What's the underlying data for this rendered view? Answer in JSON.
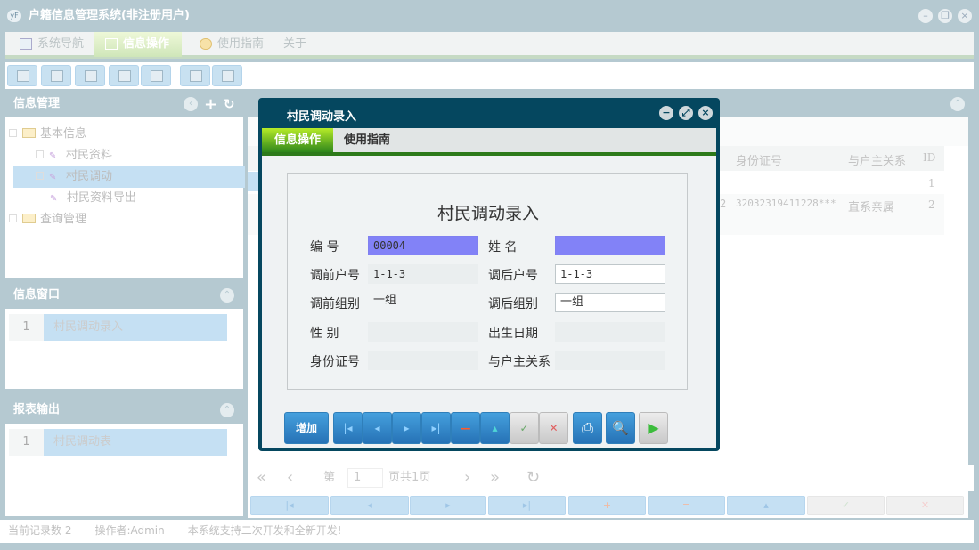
{
  "window": {
    "title": "户籍信息管理系统(非注册用户)",
    "logo": "yF",
    "controls": [
      "minimize",
      "restore",
      "close"
    ]
  },
  "menu": [
    {
      "label": "系统导航",
      "icon": "monitor-icon"
    },
    {
      "label": "信息操作",
      "icon": "grid-icon",
      "active": true
    },
    {
      "label": "使用指南",
      "icon": "help-icon"
    },
    {
      "label": "关于"
    }
  ],
  "toolbar": [
    "search-icon",
    "list-icon",
    "document-icon",
    "user-computer-icon",
    "screen-icon",
    "add-record-icon",
    "print-icon"
  ],
  "left": {
    "info_mgmt": {
      "title": "信息管理",
      "tree": [
        {
          "label": "基本信息",
          "type": "folder"
        },
        {
          "label": "村民资料",
          "type": "leaf"
        },
        {
          "label": "村民调动",
          "type": "leaf",
          "selected": true
        },
        {
          "label": "村民资料导出",
          "type": "leaf"
        },
        {
          "label": "查询管理",
          "type": "folder"
        }
      ]
    },
    "info_window": {
      "title": "信息窗口",
      "rows": [
        {
          "n": "1",
          "label": "村民调动录入"
        }
      ]
    },
    "report": {
      "title": "报表输出",
      "rows": [
        {
          "n": "1",
          "label": "村民调动表"
        }
      ]
    }
  },
  "grid": {
    "headers": [
      "身份证号",
      "与户主关系",
      "ID"
    ],
    "rows": [
      {
        "id_no": "",
        "relation": "",
        "id": "1"
      },
      {
        "prefix": "2",
        "id_no": "32032319411228***",
        "relation": "直系亲属",
        "id": "2"
      }
    ]
  },
  "pager": {
    "page_prefix": "第",
    "page": "1",
    "page_suffix": "页共1页"
  },
  "status": {
    "records": "当前记录数 2",
    "operator": "操作者:Admin",
    "note": "本系统支持二次开发和全新开发!"
  },
  "modal": {
    "title": "村民调动录入",
    "tabs": [
      "信息操作",
      "使用指南"
    ],
    "form_title": "村民调动录入",
    "fields": {
      "code_label": "编 号",
      "code": "00004",
      "name_label": "姓 名",
      "name": "",
      "before_hh_label": "调前户号",
      "before_hh": "1-1-3",
      "after_hh_label": "调后户号",
      "after_hh": "1-1-3",
      "before_group_label": "调前组别",
      "before_group": "一组",
      "after_group_label": "调后组别",
      "after_group": "一组",
      "gender_label": "性 别",
      "gender": "",
      "birth_label": "出生日期",
      "birth": "",
      "idno_label": "身份证号",
      "idno": "",
      "relation_label": "与户主关系",
      "relation": ""
    },
    "add_label": "增加"
  },
  "colors": {
    "modal": "#05475f",
    "titlebar": "#b5c9d1",
    "highlight_field": "#8282f7",
    "tab_active": "#2e861b"
  }
}
